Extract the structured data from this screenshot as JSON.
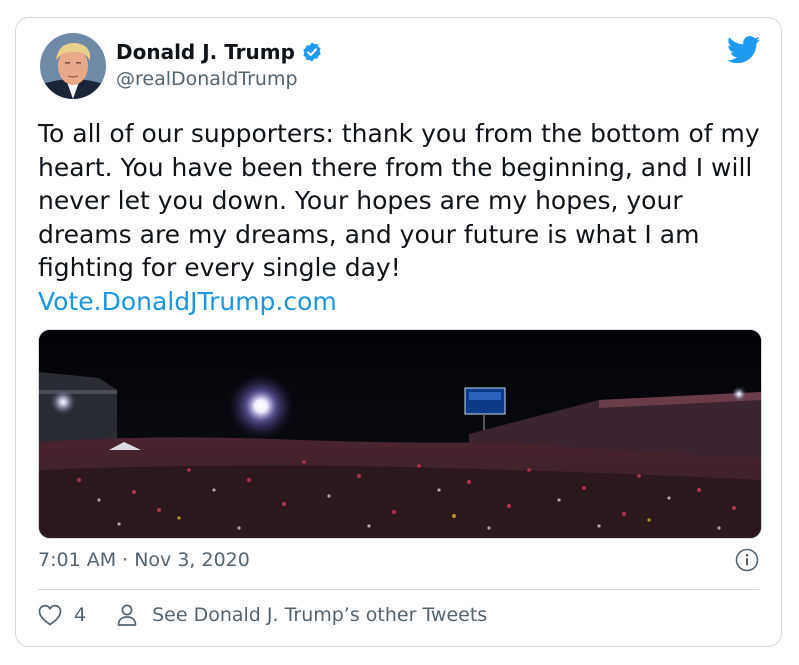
{
  "tweet": {
    "author_name": "Donald J. Trump",
    "author_handle": "@realDonaldTrump",
    "text": "To all of our supporters: thank you from the bottom of my heart. You have been there from the beginning, and I will never let you down. Your hopes are my hopes, your dreams are my dreams, and your future is what I am fighting for every single day!",
    "link": "Vote.DonaldJTrump.com",
    "timestamp": "7:01 AM · Nov 3, 2020",
    "like_count": "4",
    "other_tweets_label": "See Donald J. Trump’s other Tweets"
  },
  "icons": {
    "verified": "verified-badge-icon",
    "brand": "twitter-bird-icon",
    "info": "info-icon",
    "like": "heart-icon",
    "profile": "person-icon"
  },
  "colors": {
    "link": "#1b95e0",
    "brand": "#1d9bf0",
    "secondary_text": "#536471",
    "border": "#cfd9de"
  }
}
